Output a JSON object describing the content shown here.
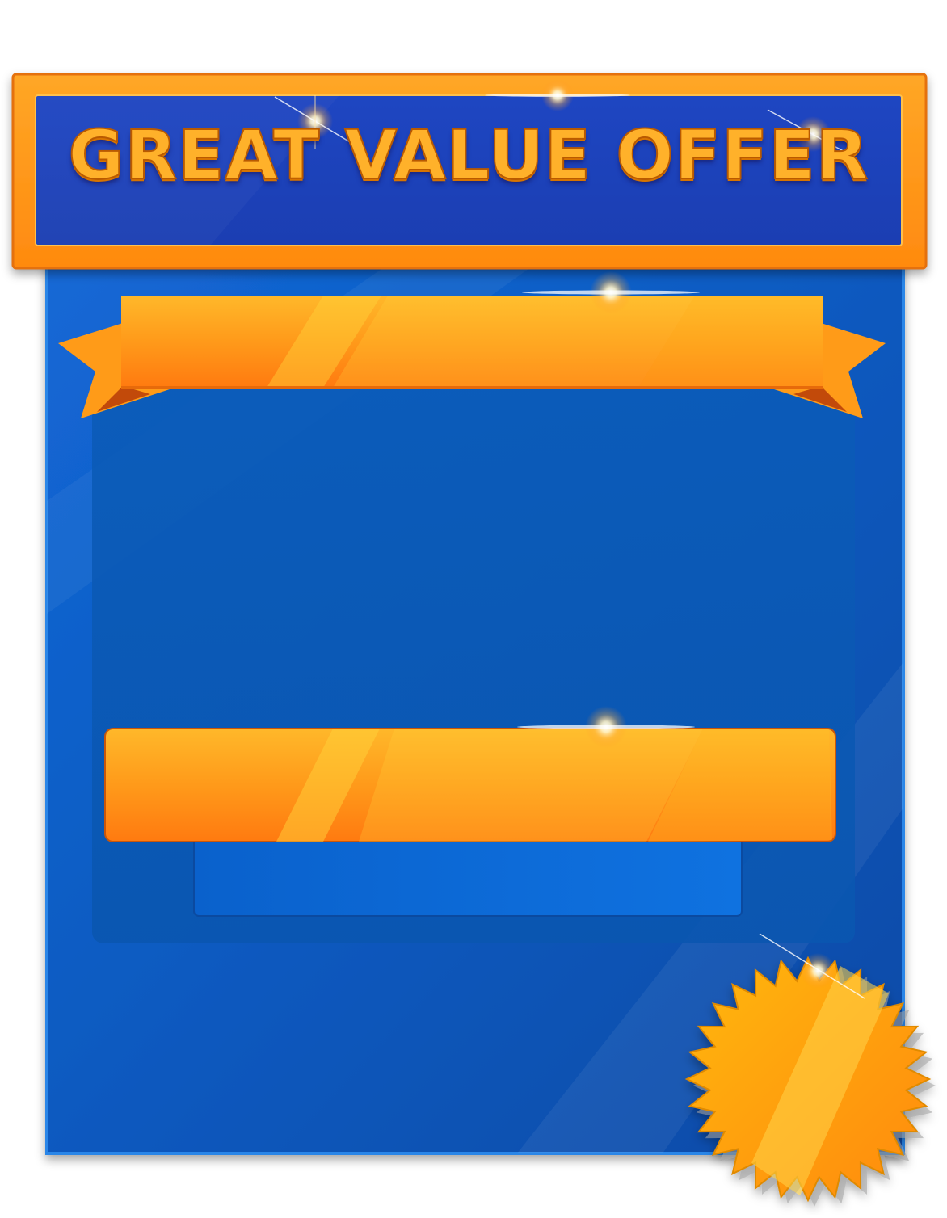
{
  "banner": {
    "title": "GREAT VALUE OFFER"
  },
  "colors": {
    "panel_blue": "#0a5ec6",
    "frame_orange": "#ff9d17",
    "ribbon_gold": "#ffc21a",
    "badge_gold": "#ffb110"
  },
  "icons": [
    "sparkle-icon",
    "starburst-badge-icon",
    "ribbon-icon"
  ]
}
